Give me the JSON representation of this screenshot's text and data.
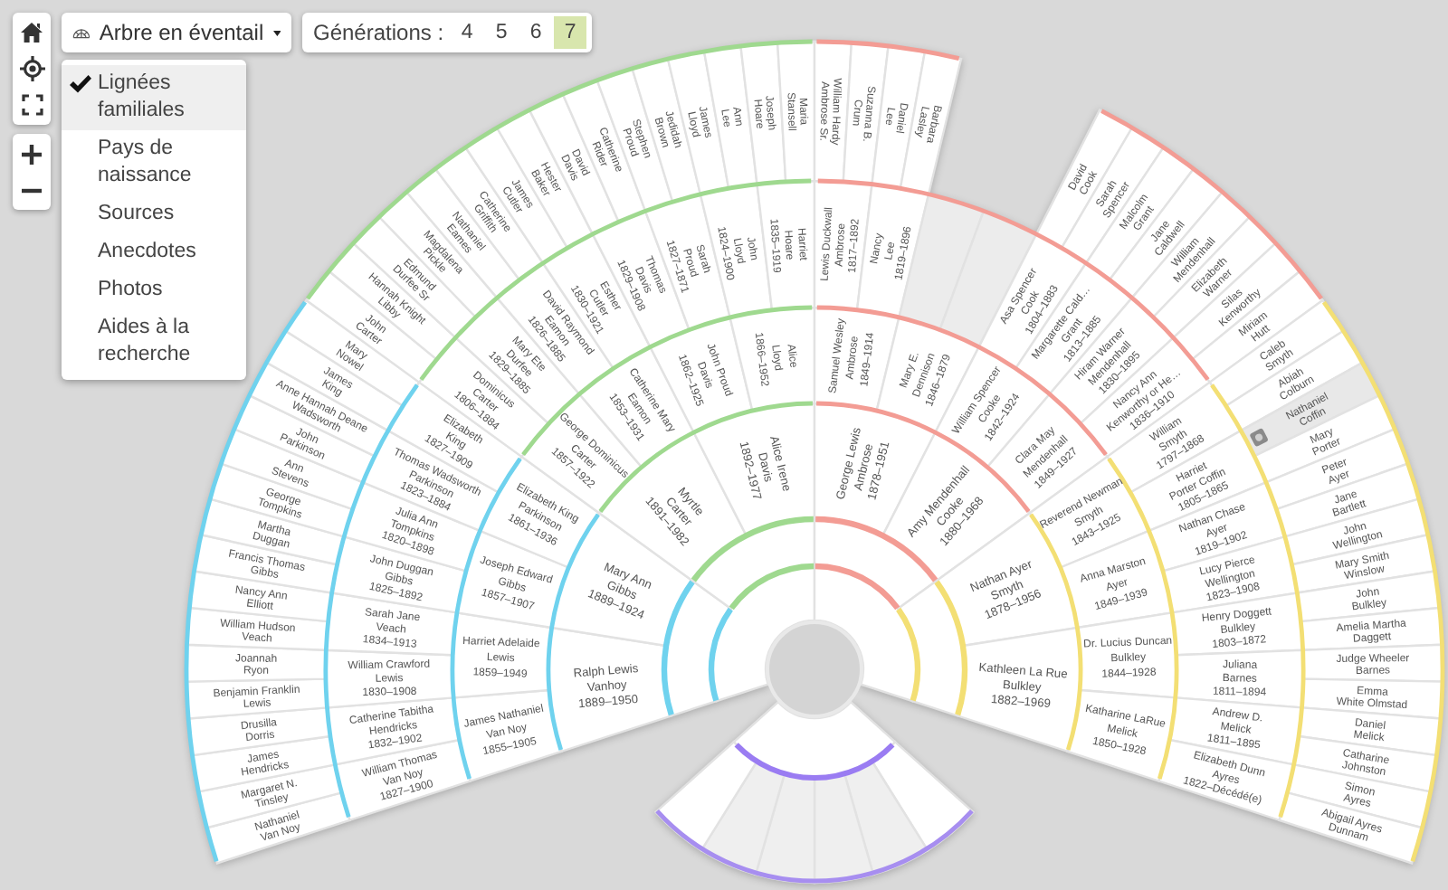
{
  "view_dropdown": {
    "label": "Arbre en éventail"
  },
  "generations": {
    "label": "Générations :",
    "options": [
      {
        "label": "4",
        "selected": false
      },
      {
        "label": "5",
        "selected": false
      },
      {
        "label": "6",
        "selected": false
      },
      {
        "label": "7",
        "selected": true
      }
    ]
  },
  "menu": {
    "items": [
      {
        "label": "Lignées familiales",
        "checked": true
      },
      {
        "label": "Pays de naissance",
        "checked": false
      },
      {
        "label": "Sources",
        "checked": false
      },
      {
        "label": "Anecdotes",
        "checked": false
      },
      {
        "label": "Photos",
        "checked": false
      },
      {
        "label": "Aides à la recherche",
        "checked": false
      }
    ]
  },
  "lineages": [
    {
      "color": "#6fd2ee"
    },
    {
      "color": "#9fd98f"
    },
    {
      "color": "#f39c94"
    },
    {
      "color": "#f3df74"
    }
  ],
  "fan": {
    "rings": [
      {
        "people": [
          {
            "given": "Ralph Lewis",
            "surname": "Vanhoy",
            "dates": "1889–1950"
          },
          {
            "given": "Mary Ann",
            "surname": "Gibbs",
            "dates": "1889–1924"
          },
          {
            "given": "Myrtle",
            "surname": "Carter",
            "dates": "1891–1982"
          },
          {
            "given": "Alice Irene",
            "surname": "Davis",
            "dates": "1892–1977"
          },
          {
            "given": "George Lewis",
            "surname": "Ambrose",
            "dates": "1878–1951"
          },
          {
            "given": "Amy Mendenhall",
            "surname": "Cooke",
            "dates": "1880–1968"
          },
          {
            "given": "Nathan Ayer",
            "surname": "Smyth",
            "dates": "1878–1956"
          },
          {
            "given": "Kathleen La Rue",
            "surname": "Bulkley",
            "dates": "1882–1969"
          }
        ]
      },
      {
        "people": [
          {
            "given": "James Nathaniel",
            "surname": "Van Noy",
            "dates": "1855–1905"
          },
          {
            "given": "Harriet Adelaide",
            "surname": "Lewis",
            "dates": "1859–1949"
          },
          {
            "given": "Joseph Edward",
            "surname": "Gibbs",
            "dates": "1857–1907"
          },
          {
            "given": "Elizabeth King",
            "surname": "Parkinson",
            "dates": "1861–1936"
          },
          {
            "given": "George Dominicus",
            "surname": "Carter",
            "dates": "1857–1922"
          },
          {
            "given": "Catherine Mary",
            "surname": "Eamon",
            "dates": "1853–1931"
          },
          {
            "given": "John Proud",
            "surname": "Davis",
            "dates": "1862–1925"
          },
          {
            "given": "Alice",
            "surname": "Lloyd",
            "dates": "1866–1952"
          },
          {
            "given": "Samuel Wesley",
            "surname": "Ambrose",
            "dates": "1849–1914"
          },
          {
            "given": "Mary E.",
            "surname": "Dennison",
            "dates": "1846–1879"
          },
          {
            "given": "William Spencer",
            "surname": "Cooke",
            "dates": "1842–1924"
          },
          {
            "given": "Clara May",
            "surname": "Mendenhall",
            "dates": "1849–1927"
          },
          {
            "given": "Reverend Newman",
            "surname": "Smyth",
            "dates": "1843–1925"
          },
          {
            "given": "Anna Marston",
            "surname": "Ayer",
            "dates": "1849–1939"
          },
          {
            "given": "Dr. Lucius Duncan",
            "surname": "Bulkley",
            "dates": "1844–1928"
          },
          {
            "given": "Katharine LaRue",
            "surname": "Melick",
            "dates": "1850–1928"
          }
        ]
      },
      {
        "people": [
          {
            "given": "William Thomas",
            "surname": "Van Noy",
            "dates": "1827–1900"
          },
          {
            "given": "Catherine Tabitha",
            "surname": "Hendricks",
            "dates": "1832–1902"
          },
          {
            "given": "William Crawford",
            "surname": "Lewis",
            "dates": "1830–1908"
          },
          {
            "given": "Sarah Jane",
            "surname": "Veach",
            "dates": "1834–1913"
          },
          {
            "given": "John Duggan",
            "surname": "Gibbs",
            "dates": "1825–1892"
          },
          {
            "given": "Julia Ann",
            "surname": "Tompkins",
            "dates": "1820–1898"
          },
          {
            "given": "Thomas Wadsworth",
            "surname": "Parkinson",
            "dates": "1823–1884"
          },
          {
            "given": "Elizabeth",
            "surname": "King",
            "dates": "1827–1909"
          },
          {
            "given": "Dominicus",
            "surname": "Carter",
            "dates": "1806–1884"
          },
          {
            "given": "Mary Ete",
            "surname": "Durfee",
            "dates": "1829–1885"
          },
          {
            "given": "David Raymond",
            "surname": "Eamon",
            "dates": "1826–1885"
          },
          {
            "given": "Esther",
            "surname": "Cutler",
            "dates": "1830–1921"
          },
          {
            "given": "Thomas",
            "surname": "Davis",
            "dates": "1829–1908"
          },
          {
            "given": "Sarah",
            "surname": "Proud",
            "dates": "1827–1871"
          },
          {
            "given": "John",
            "surname": "Lloyd",
            "dates": "1824–1900"
          },
          {
            "given": "Harriet",
            "surname": "Hoare",
            "dates": "1835–1919"
          },
          {
            "given": "Lewis Duckwall",
            "surname": "Ambrose",
            "dates": "1817–1892"
          },
          {
            "given": "Nancy",
            "surname": "Lee",
            "dates": "1819–1896"
          },
          {
            "empty": true
          },
          {
            "empty": true
          },
          {
            "given": "Asa Spencer",
            "surname": "Cook",
            "dates": "1804–1883"
          },
          {
            "given": "Margarette Cald…",
            "surname": "Grant",
            "dates": "1813–1885"
          },
          {
            "given": "Hiram Warner",
            "surname": "Mendenhall",
            "dates": "1830–1895"
          },
          {
            "given": "Nancy Ann",
            "surname": "Kenworthy or He…",
            "dates": "1836–1910"
          },
          {
            "given": "William",
            "surname": "Smyth",
            "dates": "1797–1868"
          },
          {
            "given": "Harriet",
            "surname": "Porter Coffin",
            "dates": "1805–1865"
          },
          {
            "given": "Nathan Chase",
            "surname": "Ayer",
            "dates": "1819–1902"
          },
          {
            "given": "Lucy Pierce",
            "surname": "Wellington",
            "dates": "1823–1908"
          },
          {
            "given": "Henry Doggett",
            "surname": "Bulkley",
            "dates": "1803–1872"
          },
          {
            "given": "Juliana",
            "surname": "Barnes",
            "dates": "1811–1894"
          },
          {
            "given": "Andrew D.",
            "surname": "Melick",
            "dates": "1811–1895"
          },
          {
            "given": "Elizabeth Dunn",
            "surname": "Ayres",
            "dates": "1822–Décédé(e)"
          }
        ]
      },
      {
        "people": [
          {
            "given": "Nathaniel",
            "surname": "Van Noy",
            "selected": false
          },
          {
            "given": "Margaret N.",
            "surname": "Tinsley",
            "selected": false
          },
          {
            "given": "James",
            "surname": "Hendricks",
            "selected": false
          },
          {
            "given": "Drusilla",
            "surname": "Dorris",
            "selected": false
          },
          {
            "given": "Benjamin Franklin",
            "surname": "Lewis",
            "selected": false
          },
          {
            "given": "Joannah",
            "surname": "Ryon",
            "selected": false
          },
          {
            "given": "William Hudson",
            "surname": "Veach",
            "selected": false
          },
          {
            "given": "Nancy Ann",
            "surname": "Elliott",
            "selected": false
          },
          {
            "given": "Francis Thomas",
            "surname": "Gibbs",
            "selected": false
          },
          {
            "given": "Martha",
            "surname": "Duggan",
            "selected": false
          },
          {
            "given": "George",
            "surname": "Tompkins",
            "selected": false
          },
          {
            "given": "Ann",
            "surname": "Stevens",
            "selected": false
          },
          {
            "given": "John",
            "surname": "Parkinson",
            "selected": false
          },
          {
            "given": "Anne Hannah Deane",
            "surname": "Wadsworth",
            "selected": false
          },
          {
            "given": "James",
            "surname": "King",
            "selected": false
          },
          {
            "given": "Mary",
            "surname": "Nowel",
            "selected": false
          },
          {
            "given": "John",
            "surname": "Carter",
            "selected": false
          },
          {
            "given": "Hannah Knight",
            "surname": "Libby",
            "selected": false
          },
          {
            "given": "Edmund",
            "surname": "Durfee Sr",
            "selected": false
          },
          {
            "given": "Magdalena",
            "surname": "Pickle",
            "selected": false
          },
          {
            "given": "Nathaniel",
            "surname": "Eames",
            "selected": false
          },
          {
            "given": "Catherine",
            "surname": "Griffith",
            "selected": false
          },
          {
            "given": "James",
            "surname": "Cutler",
            "selected": false
          },
          {
            "given": "Hester",
            "surname": "Baker",
            "selected": false
          },
          {
            "given": "David",
            "surname": "Davis",
            "selected": false
          },
          {
            "given": "Catherine",
            "surname": "Rider",
            "selected": false
          },
          {
            "given": "Stephen",
            "surname": "Proud",
            "selected": false
          },
          {
            "given": "Jedidah",
            "surname": "Brown",
            "selected": false
          },
          {
            "given": "James",
            "surname": "Lloyd",
            "selected": false
          },
          {
            "given": "Ann",
            "surname": "Lee",
            "selected": false
          },
          {
            "given": "Joseph",
            "surname": "Hoare",
            "selected": false
          },
          {
            "given": "Maria",
            "surname": "Stansell",
            "selected": false
          },
          {
            "given": "William Hardy",
            "surname": "Ambrose Sr.",
            "selected": false
          },
          {
            "given": "Suzanna B.",
            "surname": "Crum",
            "selected": false
          },
          {
            "given": "Daniel",
            "surname": "Lee",
            "selected": false
          },
          {
            "given": "Barbara",
            "surname": "Lasley",
            "selected": false
          },
          {
            "given": "David",
            "surname": "Cook",
            "selected": false
          },
          {
            "given": "Sarah",
            "surname": "Spencer",
            "selected": false
          },
          {
            "given": "Malcolm",
            "surname": "Grant",
            "selected": false
          },
          {
            "given": "Jane",
            "surname": "Caldwell",
            "selected": false
          },
          {
            "given": "William",
            "surname": "Mendenhall",
            "selected": false
          },
          {
            "given": "Elizabeth",
            "surname": "Warner",
            "selected": false
          },
          {
            "given": "Silas",
            "surname": "Kenworthy",
            "selected": false
          },
          {
            "given": "Miriam",
            "surname": "Hutt",
            "selected": false
          },
          {
            "given": "Caleb",
            "surname": "Smyth",
            "selected": false
          },
          {
            "given": "Abiah",
            "surname": "Colburn",
            "selected": false
          },
          {
            "given": "Nathaniel",
            "surname": "Coffin",
            "selected": true
          },
          {
            "given": "Mary",
            "surname": "Porter",
            "selected": false
          },
          {
            "given": "Peter",
            "surname": "Ayer",
            "selected": false
          },
          {
            "given": "Jane",
            "surname": "Bartlett",
            "selected": false
          },
          {
            "given": "John",
            "surname": "Wellington",
            "selected": false
          },
          {
            "given": "Mary Smith",
            "surname": "Winslow",
            "selected": false
          },
          {
            "given": "John",
            "surname": "Bulkley",
            "selected": false
          },
          {
            "given": "Amelia Martha",
            "surname": "Daggett",
            "selected": false
          },
          {
            "given": "Judge Wheeler",
            "surname": "Barnes",
            "selected": false
          },
          {
            "given": "Emma",
            "surname": "White Olmstad",
            "selected": false
          },
          {
            "given": "Daniel",
            "surname": "Melick",
            "selected": false
          },
          {
            "given": "Catharine",
            "surname": "Johnston",
            "selected": false
          },
          {
            "given": "Simon",
            "surname": "Ayres",
            "selected": false
          },
          {
            "given": "Abigail Ayres",
            "surname": "Dunnam",
            "selected": false
          }
        ]
      }
    ]
  }
}
